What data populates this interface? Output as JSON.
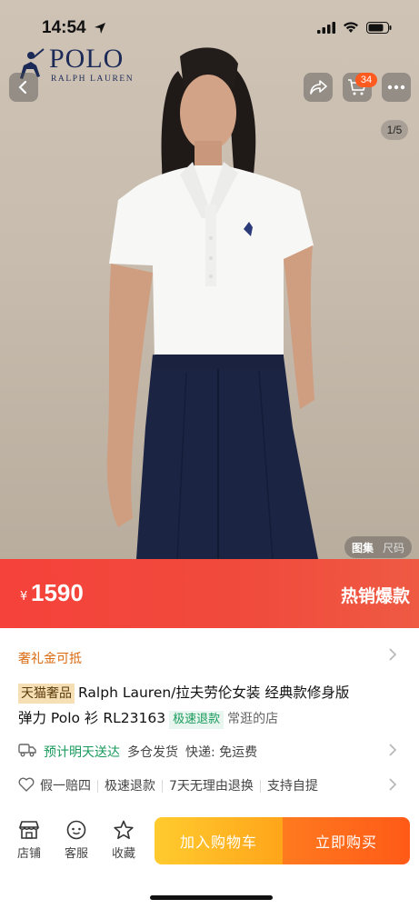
{
  "status_bar": {
    "time": "14:54"
  },
  "brand": {
    "name": "POLO",
    "sub": "RALPH LAUREN"
  },
  "header": {
    "cart_count": "34",
    "image_counter": "1/5"
  },
  "media_tabs": [
    "图集",
    "尺码"
  ],
  "price": {
    "currency": "¥",
    "value": "1590",
    "hot_label": "热销爆款"
  },
  "gift": {
    "label": "奢礼金可抵"
  },
  "product": {
    "tag": "天猫奢品",
    "title_line1": "Ralph Lauren/拉夫劳伦女装 经典款修身版",
    "title_line2": "弹力 Polo 衫 RL23163",
    "fast_refund": "极速退款",
    "shop_note": "常逛的店"
  },
  "delivery": {
    "main": "预计明天送达",
    "warehouse": "多仓发货",
    "express": "快递: 免运费"
  },
  "guarantees": [
    "假一赔四",
    "极速退款",
    "7天无理由退换",
    "支持自提"
  ],
  "bottom_nav": {
    "store": "店铺",
    "service": "客服",
    "favorite": "收藏",
    "add_to_cart": "加入购物车",
    "buy_now": "立即购买"
  },
  "colors": {
    "price_banner": "#f4473b",
    "gift_text": "#d96a10",
    "delivery_green": "#1a9a5c",
    "add_cart": "#ffb522",
    "buy_now": "#ff6a1a"
  }
}
